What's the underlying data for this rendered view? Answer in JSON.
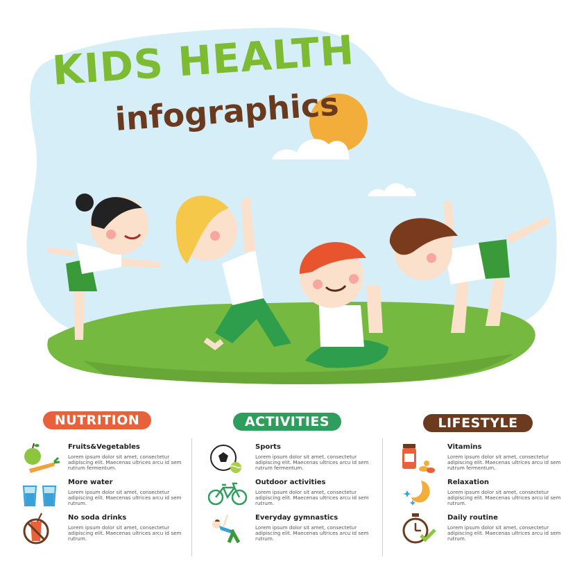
{
  "header": {
    "title": "KIDS HEALTH",
    "subtitle": "infographics"
  },
  "sections": [
    {
      "label": "NUTRITION",
      "color": "#e8613a",
      "items": [
        {
          "title": "Fruits&Vegetables",
          "icon": "fruits-vegetables-icon",
          "text": "Lorem ipsum dolor sit amet, consectetur adipiscing elit. Maecenas ultrices arcu id sem rutrum fermentum."
        },
        {
          "title": "More water",
          "icon": "water-glasses-icon",
          "text": "Lorem ipsum dolor sit amet, consectetur adipiscing elit. Maecenas ultrices arcu id sem rutrum."
        },
        {
          "title": "No soda drinks",
          "icon": "no-soda-icon",
          "text": "Lorem ipsum dolor sit amet, consectetur adipiscing elit. Maecenas ultrices arcu id sem rutrum."
        }
      ]
    },
    {
      "label": "ACTIVITIES",
      "color": "#2f9e5c",
      "items": [
        {
          "title": "Sports",
          "icon": "sports-balls-icon",
          "text": "Lorem ipsum dolor sit amet, consectetur adipiscing elit. Maecenas ultrices arcu id sem rutrum fermentum."
        },
        {
          "title": "Outdoor activities",
          "icon": "bicycle-icon",
          "text": "Lorem ipsum dolor sit amet, consectetur adipiscing elit. Maecenas ultrices arcu id sem rutrum."
        },
        {
          "title": "Everyday gymnastics",
          "icon": "gymnastics-icon",
          "text": "Lorem ipsum dolor sit amet, consectetur adipiscing elit. Maecenas ultrices arcu id sem rutrum."
        }
      ]
    },
    {
      "label": "LIFESTYLE",
      "color": "#6b3a1f",
      "items": [
        {
          "title": "Vitamins",
          "icon": "vitamins-icon",
          "text": "Lorem ipsum dolor sit amet, consectetur adipiscing elit. Maecenas ultrices arcu id sem rutrum fermentum."
        },
        {
          "title": "Relaxation",
          "icon": "moon-stars-icon",
          "text": "Lorem ipsum dolor sit amet, consectetur adipiscing elit. Maecenas ultrices arcu id sem rutrum."
        },
        {
          "title": "Daily routine",
          "icon": "stopwatch-check-icon",
          "text": "Lorem ipsum dolor sit amet, consectetur adipiscing elit. Maecenas ultrices arcu id sem rutrum."
        }
      ]
    }
  ],
  "colors": {
    "title_green": "#7cbb32",
    "subtitle_brown": "#6a3a1e",
    "sky": "#d6eef8",
    "grass": "#76b941",
    "sun": "#f3ad3b"
  }
}
